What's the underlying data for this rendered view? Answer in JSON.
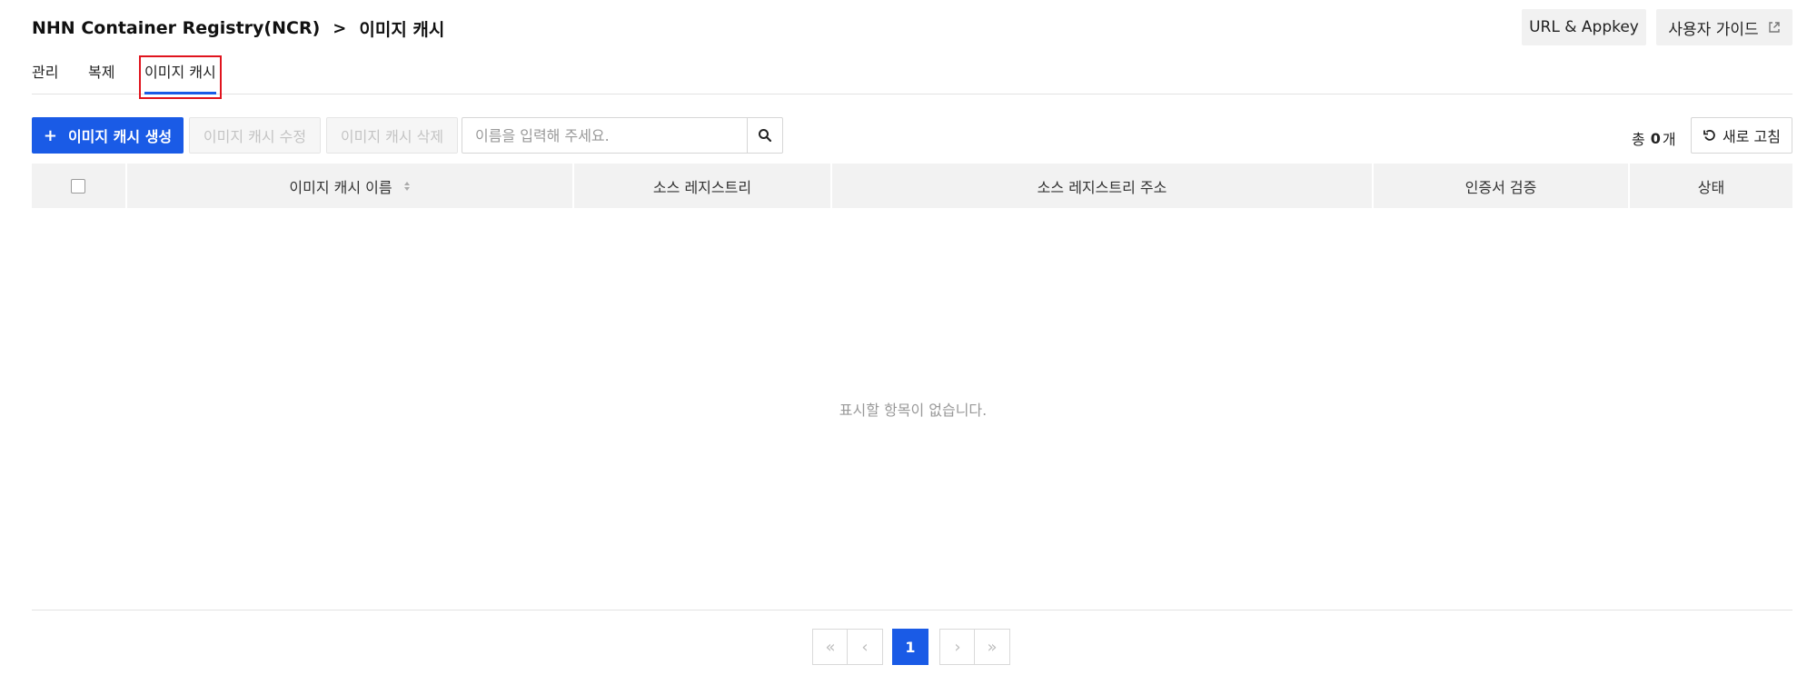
{
  "header": {
    "breadcrumb_root": "NHN Container Registry(NCR)",
    "breadcrumb_sep": ">",
    "breadcrumb_current": "이미지 캐시",
    "url_appkey_label": "URL & Appkey",
    "user_guide_label": "사용자 가이드"
  },
  "tabs": [
    {
      "label": "관리"
    },
    {
      "label": "복제"
    },
    {
      "label": "이미지 캐시",
      "active": true
    }
  ],
  "toolbar": {
    "create_label": "이미지 캐시 생성",
    "edit_label": "이미지 캐시 수정",
    "delete_label": "이미지 캐시 삭제",
    "search_placeholder": "이름을 입력해 주세요.",
    "total_prefix": "총",
    "total_count": "0",
    "total_suffix": "개",
    "refresh_label": "새로 고침"
  },
  "table": {
    "columns": [
      "이미지 캐시 이름",
      "소스 레지스트리",
      "소스 레지스트리 주소",
      "인증서 검증",
      "상태"
    ],
    "rows": [],
    "empty_message": "표시할 항목이 없습니다."
  },
  "pagination": {
    "current_page": "1"
  },
  "colors": {
    "accent": "#1a5be6",
    "highlight_box": "#e0141e",
    "header_bg": "#f2f2f2"
  }
}
